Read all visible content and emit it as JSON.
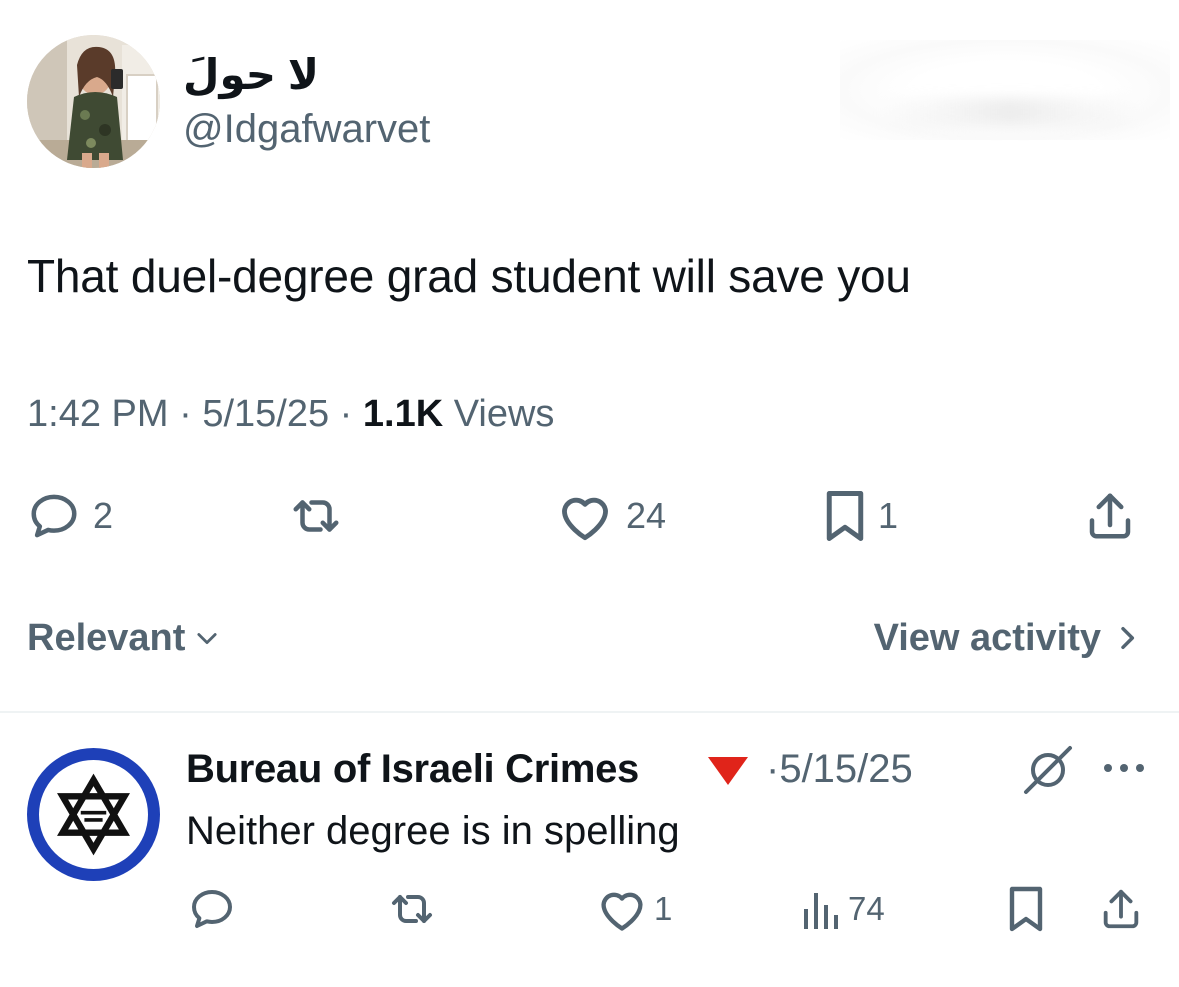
{
  "tweet": {
    "display_name": "لا حولَ",
    "handle": "@Idgafwarvet",
    "text": "That duel-degree grad student will save you",
    "time": "1:42 PM",
    "separator": "·",
    "date": "5/15/25",
    "views_count": "1.1K",
    "views_label": "Views",
    "actions": {
      "replies": "2",
      "likes": "24",
      "bookmarks": "1"
    }
  },
  "sort": {
    "label": "Relevant",
    "view_activity": "View activity"
  },
  "reply": {
    "display_name": "Bureau of Israeli Crimes",
    "date": "·5/15/25",
    "text": "Neither degree is in spelling",
    "actions": {
      "likes": "1",
      "views": "74"
    }
  },
  "icons": {
    "main_actions": [
      "comment-icon",
      "retweet-icon",
      "heart-icon",
      "bookmark-icon",
      "share-icon"
    ],
    "reply_actions": [
      "comment-icon",
      "retweet-icon",
      "heart-icon",
      "views-icon",
      "bookmark-icon",
      "share-icon"
    ],
    "header": [
      "grok-icon",
      "more-icon",
      "red-triangle-icon",
      "star-of-david-icon"
    ]
  },
  "colors": {
    "text_primary": "#0f1419",
    "text_secondary": "#536471",
    "divider": "#eff3f4",
    "badge_red": "#e0241a",
    "avatar_blue": "#1e40b8"
  }
}
